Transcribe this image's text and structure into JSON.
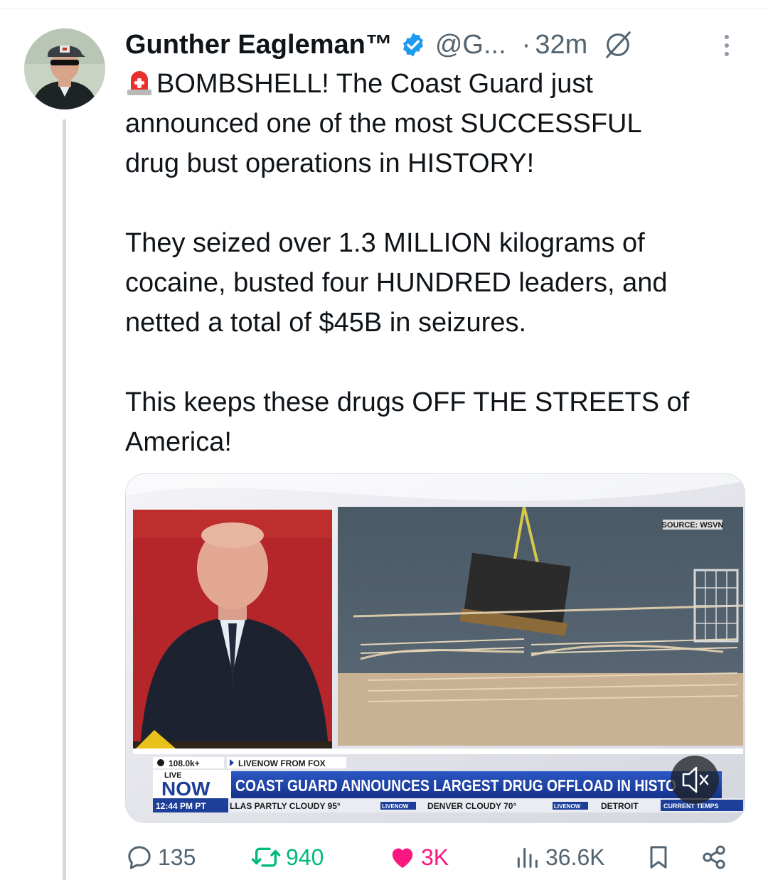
{
  "post": {
    "author_name": "Gunther Eagleman™",
    "handle": "@G...",
    "separator": "·",
    "time": "32m",
    "text_line1": "BOMBSHELL! The Coast Guard just",
    "text_rest": "announced one of the most SUCCESSFUL\ndrug bust operations in HISTORY!\n\nThey seized over 1.3 MILLION kilograms of\ncocaine, busted four HUNDRED leaders, and\nnetted a total of $45B in seizures.\n\nThis keeps these drugs OFF THE STREETS of\nAmerica!",
    "verified_icon": "verified-badge-icon",
    "emoji_icon": "siren-emoji-icon"
  },
  "video": {
    "source_label": "SOURCE: WSVN",
    "views_label": "108.0k+",
    "livenow_from": "LIVENOW FROM FOX",
    "live_label": "LIVE",
    "now_label": "NOW",
    "headline": "COAST GUARD ANNOUNCES LARGEST DRUG OFFLOAD IN HISTO",
    "time_label": "12:44 PM PT",
    "ticker": "LLAS   PARTLY CLOUDY 95°",
    "ticker_mid": "DENVER   CLOUDY 70°",
    "ticker_end": "DETROIT",
    "ticker_badge1": "LIVENOW",
    "ticker_badge2": "LIVENOW",
    "current_temps": "CURRENT TEMPS",
    "mute_icon": "mute-icon"
  },
  "actions": {
    "replies": "135",
    "reposts": "940",
    "likes": "3K",
    "views": "36.6K"
  },
  "colors": {
    "verified": "#1d9bf0",
    "repost": "#00ba7c",
    "like": "#f91880",
    "secondary_text": "#536471",
    "fox_blue": "#1d3f9a"
  }
}
